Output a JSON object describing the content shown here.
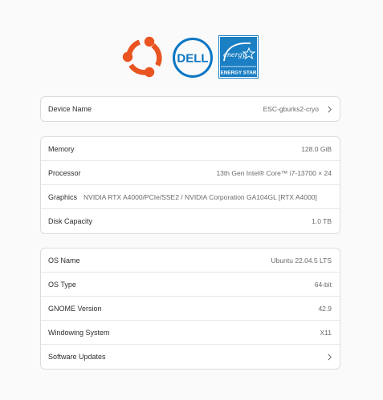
{
  "logos": {
    "ubuntu_icon": "ubuntu-logo",
    "dell_icon": "dell-logo",
    "dell_text": "DELL",
    "energy_icon": "energy-star-logo",
    "energy_script": "energy",
    "energy_label": "ENERGY STAR"
  },
  "device": {
    "label": "Device Name",
    "value": "ESC-gburks2-cryo",
    "chevron_icon": "chevron-right-icon"
  },
  "hardware": {
    "memory": {
      "label": "Memory",
      "value": "128.0 GiB"
    },
    "processor": {
      "label": "Processor",
      "value": "13th Gen Intel® Core™ i7-13700 × 24"
    },
    "graphics": {
      "label": "Graphics",
      "value": "NVIDIA RTX A4000/PCIe/SSE2 / NVIDIA Corporation GA104GL [RTX A4000]"
    },
    "disk": {
      "label": "Disk Capacity",
      "value": "1.0 TB"
    }
  },
  "os": {
    "name": {
      "label": "OS Name",
      "value": "Ubuntu 22.04.5 LTS"
    },
    "type": {
      "label": "OS Type",
      "value": "64-bit"
    },
    "gnome": {
      "label": "GNOME Version",
      "value": "42.9"
    },
    "windowing": {
      "label": "Windowing System",
      "value": "X11"
    },
    "updates": {
      "label": "Software Updates",
      "chevron_icon": "chevron-right-icon"
    }
  },
  "colors": {
    "ubuntu_orange": "#e95420",
    "dell_blue": "#0a76c4",
    "energy_blue": "#1b7fc4"
  }
}
